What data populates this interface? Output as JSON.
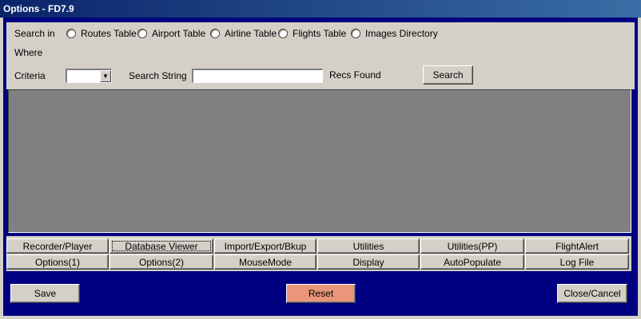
{
  "window": {
    "title": "Options - FD7.9"
  },
  "search": {
    "search_in_label": "Search in",
    "where_label": "Where",
    "criteria_label": "Criteria",
    "criteria_value": "",
    "search_string_label": "Search String",
    "search_string_value": "",
    "recs_found_label": "Recs Found",
    "search_button": "Search",
    "radios": [
      {
        "label": "Routes Table",
        "selected": false
      },
      {
        "label": "Airport Table",
        "selected": false
      },
      {
        "label": "Airline Table",
        "selected": false
      },
      {
        "label": "Flights Table",
        "selected": false
      },
      {
        "label": "Images Directory",
        "selected": false
      }
    ]
  },
  "tabs": {
    "row1": [
      "Recorder/Player",
      "Database Viewer",
      "Import/Export/Bkup",
      "Utilities",
      "Utilities(PP)",
      "FlightAlert"
    ],
    "row2": [
      "Options(1)",
      "Options(2)",
      "MouseMode",
      "Display",
      "AutoPopulate",
      "Log File"
    ],
    "active": "Database Viewer"
  },
  "footer": {
    "save_label": "Save",
    "reset_label": "Reset",
    "close_label": "Close/Cancel"
  },
  "colors": {
    "title_bar": "#0a246a",
    "client_bg": "#000080",
    "panel_bg": "#d4d0c8",
    "grid_bg": "#808080",
    "reset_button": "#e9967a"
  }
}
